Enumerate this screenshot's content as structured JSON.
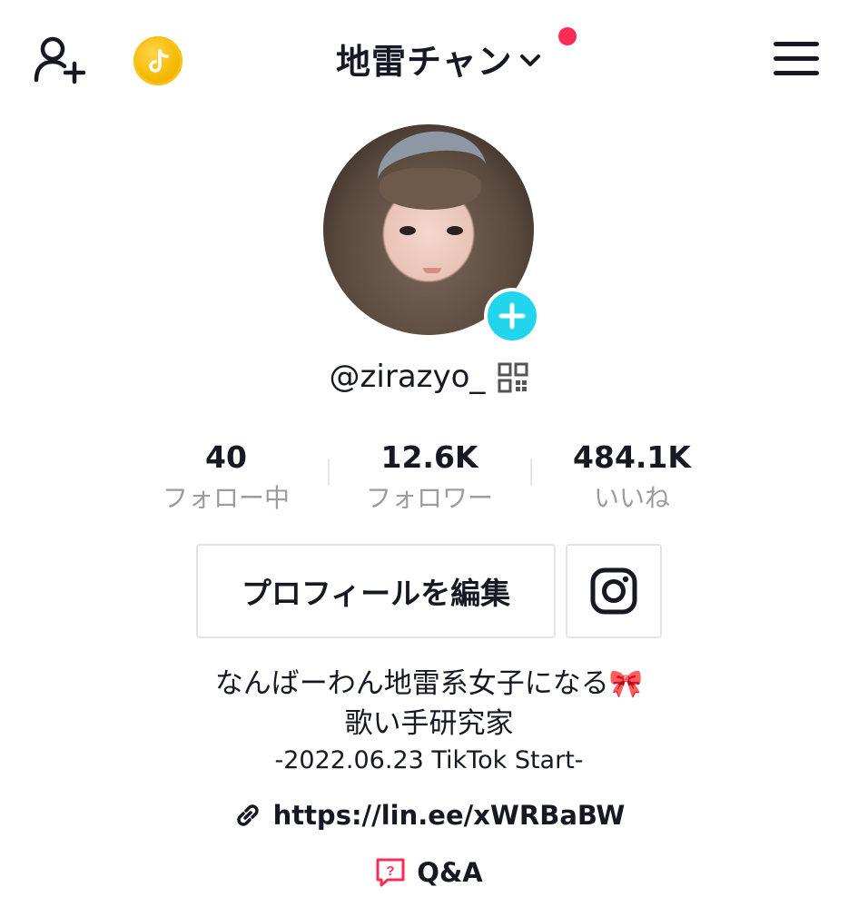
{
  "header": {
    "title": "地雷チャン",
    "accent_color": "#fe2c55",
    "coin_color": "#f5b800",
    "icons": [
      "add-user-icon",
      "tiktok-coin-icon",
      "chevron-down-icon",
      "menu-icon"
    ]
  },
  "profile": {
    "username": "@zirazyo_",
    "badge_color": "#20d5ec"
  },
  "stats": [
    {
      "value": "40",
      "label": "フォロー中"
    },
    {
      "value": "12.6K",
      "label": "フォロワー"
    },
    {
      "value": "484.1K",
      "label": "いいね"
    }
  ],
  "actions": {
    "edit_profile": "プロフィールを編集",
    "instagram_icon": "instagram-icon"
  },
  "bio": {
    "line1": "なんばーわん地雷系女子になる",
    "line1_emoji": "🎀",
    "line2": "歌い手研究家",
    "line3": "-2022.06.23 TikTok Start-"
  },
  "link": {
    "url": "https://lin.ee/xWRBaBW"
  },
  "qa": {
    "label": "Q&A",
    "icon_color": "#fe2c55"
  }
}
